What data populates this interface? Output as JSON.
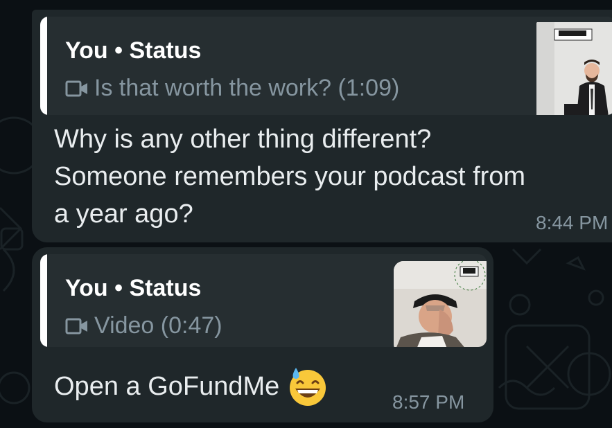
{
  "messages": [
    {
      "quote_author": "You • Status",
      "quote_text": "Is that worth the work? (1:09)",
      "quote_media_icon": "video-camera-icon",
      "body": "Why is any other thing different?\nSomeone remembers your podcast from\na year ago?",
      "time": "8:44 PM"
    },
    {
      "quote_author": "You • Status",
      "quote_text": "Video (0:47)",
      "quote_media_icon": "video-camera-icon",
      "body": "Open a GoFundMe",
      "body_emoji": "grinning-face-with-sweat-emoji",
      "time": "8:57 PM"
    }
  ],
  "colors": {
    "background": "#0b1014",
    "bubble": "#1f272a",
    "quote_bg": "#262e31",
    "quote_bar": "#ffffff",
    "secondary_text": "#8696a0",
    "primary_text": "#e9edef"
  }
}
